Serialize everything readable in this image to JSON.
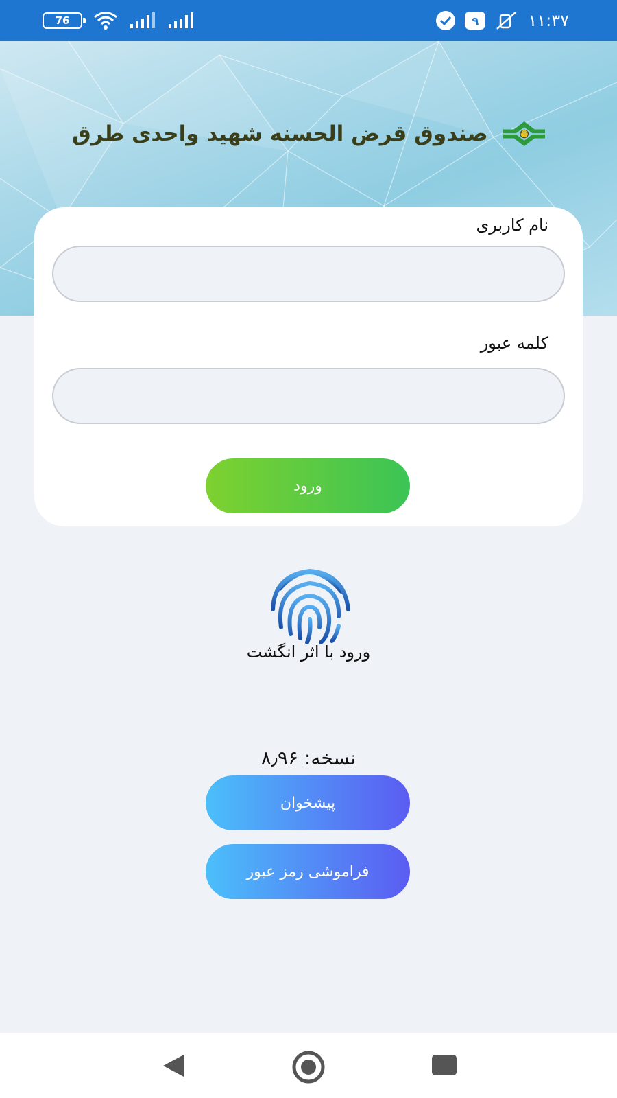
{
  "status_bar": {
    "battery_level": "76",
    "time": "۱۱:۳۷",
    "notification_count": "۹",
    "icons": [
      "battery-icon",
      "wifi-icon",
      "signal-icon",
      "signal-icon",
      "check-circle-icon",
      "mute-icon"
    ]
  },
  "header": {
    "brand_name": "صندوق قرض الحسنه شهید واحدی طرق",
    "logo_colors": {
      "green": "#2e9a3e",
      "gold": "#e7c21a"
    }
  },
  "login_form": {
    "username_label": "نام کاربری",
    "username_value": "",
    "password_label": "کلمه عبور",
    "password_value": "",
    "login_button": "ورود"
  },
  "fingerprint": {
    "label": "ورود با اثر انگشت"
  },
  "footer": {
    "version_label": "نسخه:",
    "version_number": "۸٫۹۶",
    "counter_button": "پیشخوان",
    "forgot_password_button": "فراموشی رمز عبور"
  },
  "colors": {
    "status_bar": "#1f76d1",
    "login_gradient": [
      "#7ed12f",
      "#3bc456"
    ],
    "blue_gradient": [
      "#4bbffa",
      "#5b5cf2"
    ],
    "background": "#eff2f6"
  }
}
